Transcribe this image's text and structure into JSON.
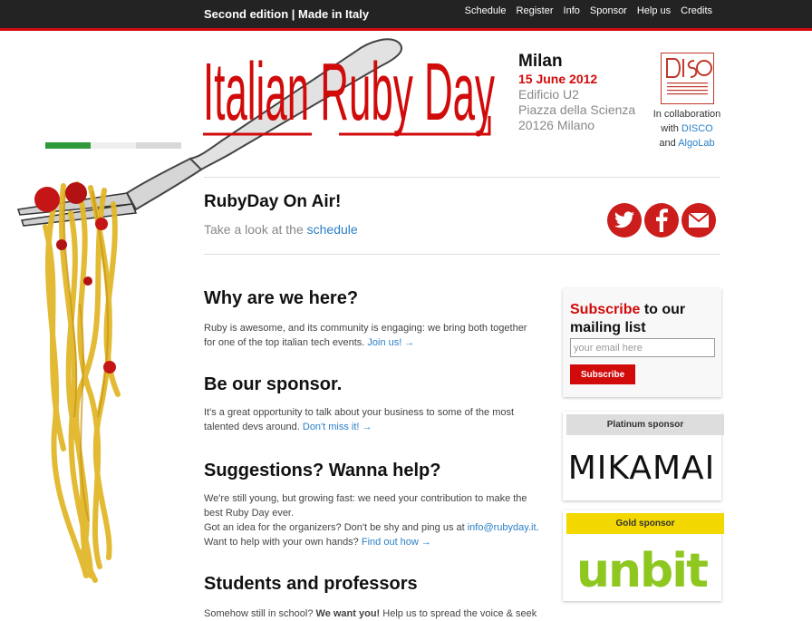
{
  "header": {
    "tagline": "Second edition | Made in Italy",
    "nav": [
      "Schedule",
      "Register",
      "Info",
      "Sponsor",
      "Help us",
      "Credits"
    ]
  },
  "logo": {
    "text": "Italian Ruby Day"
  },
  "event": {
    "city": "Milan",
    "date": "15 June 2012",
    "address": [
      "Edificio U2",
      "Piazza della Scienza",
      "20126 Milano"
    ]
  },
  "collab": {
    "prefix": "In collaboration",
    "with": "with",
    "disco": "DISCO",
    "and": "and",
    "algolab": "AlgoLab",
    "disco_logo_caption": "DIPARTIMENTO DI INFORMATICA SISTEMISTICA E COMUNICAZIONE"
  },
  "onair": {
    "title": "RubyDay On Air!",
    "subtitle_prefix": "Take a look at the",
    "subtitle_link": "schedule"
  },
  "social_icons": [
    "twitter-icon",
    "facebook-icon",
    "mail-icon"
  ],
  "sections": [
    {
      "title": "Why are we here?",
      "text": "Ruby is awesome, and its community is engaging: we bring both together for one of the top italian tech events.",
      "link": "Join us! →"
    },
    {
      "title": "Be our sponsor.",
      "text": "It's a great opportunity to talk about your business to some of the most talented devs around.",
      "link": "Don't miss it! →"
    },
    {
      "title": "Suggestions? Wanna help?",
      "text": "We're still young, but growing fast: we need your contribution to make the best Ruby Day ever.",
      "text2": "Got an idea for the organizers? Don't be shy and ping us at",
      "email": "info@rubyday.it",
      "text2_end": ".",
      "text3": "Want to help with your own hands?",
      "link": "Find out how →"
    },
    {
      "title": "Students and professors",
      "text": "Somehow still in school?",
      "bold": "We want you!",
      "text_end": "Help us to spread the voice & seek"
    }
  ],
  "subscribe": {
    "red": "Subscribe",
    "rest": "to our",
    "line2": "mailing list",
    "placeholder": "your email here",
    "button": "Subscribe"
  },
  "sponsors": {
    "platinum_label": "Platinum sponsor",
    "platinum_logo": "MIKAMAI",
    "platinum_label_bg": "#dddddd",
    "gold_label": "Gold sponsor",
    "gold_logo": "unbit",
    "gold_label_bg": "#f3d800"
  },
  "colors": {
    "accent": "#d10a0a",
    "link": "#2a7fc7",
    "topbar": "#232323"
  }
}
